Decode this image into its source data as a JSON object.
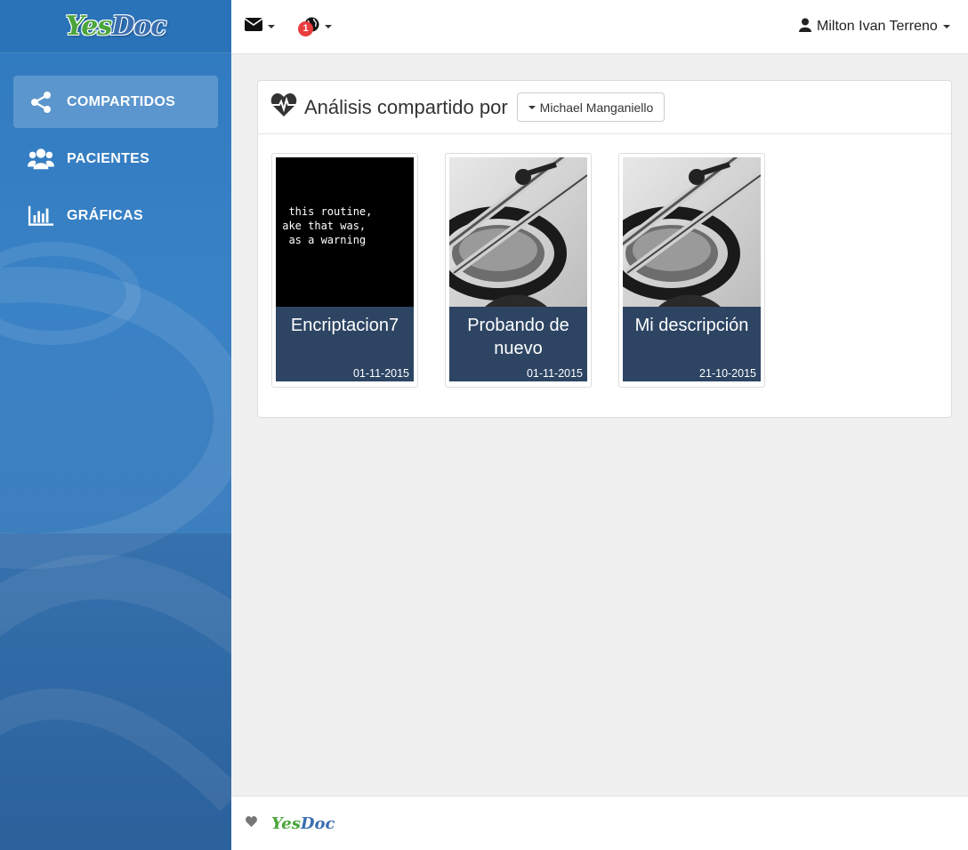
{
  "brand": {
    "yes": "Yes",
    "doc": "Doc"
  },
  "sidebar": {
    "items": [
      {
        "label": "COMPARTIDOS",
        "icon": "share-icon",
        "active": true
      },
      {
        "label": "PACIENTES",
        "icon": "users-icon",
        "active": false
      },
      {
        "label": "GRÁFICAS",
        "icon": "bar-chart-icon",
        "active": false
      }
    ]
  },
  "topbar": {
    "mail_icon": "envelope-icon",
    "globe_icon": "globe-icon",
    "notification_count": "1",
    "user_name": "Milton Ivan Terreno",
    "user_icon": "user-icon"
  },
  "panel": {
    "title": "Análisis compartido por",
    "title_icon": "heartbeat-icon",
    "filter_value": "Michael Manganiello"
  },
  "cards": [
    {
      "title": "Encriptacion7",
      "date": "01-11-2015",
      "image": "terminal-text",
      "image_lines": [
        "  this routine,",
        " ake that was,",
        "  as a warning"
      ]
    },
    {
      "title": "Probando de nuevo",
      "date": "01-11-2015",
      "image": "stethoscope-photo"
    },
    {
      "title": "Mi descripción",
      "date": "21-10-2015",
      "image": "stethoscope-photo"
    }
  ],
  "footer": {
    "heart_icon": "heart-icon",
    "yes": "Yes",
    "doc": "Doc"
  },
  "colors": {
    "sidebar": "#3a82c6",
    "card_caption": "#2d4563",
    "badge": "#e83e3e",
    "brand_green": "#4aa53a",
    "brand_blue": "#3a6fb0"
  }
}
